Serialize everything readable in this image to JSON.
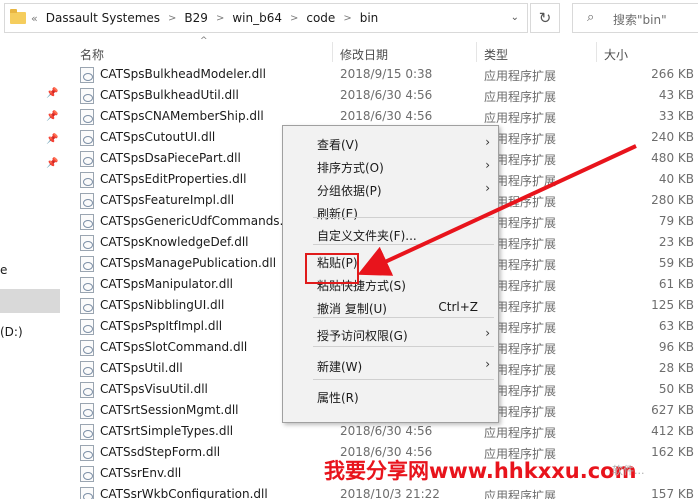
{
  "address": {
    "crumb_back": "«",
    "crumbs": [
      "Dassault Systemes",
      "B29",
      "win_b64",
      "code",
      "bin"
    ],
    "separator": ">",
    "dropdown": "⌄",
    "refresh": "↻",
    "search_placeholder": "搜索\"bin\""
  },
  "nav": {
    "label_e": "e",
    "label_drive": "(D:)"
  },
  "columns": {
    "name": "名称",
    "date": "修改日期",
    "type": "类型",
    "size": "大小",
    "sort_indicator": "^"
  },
  "files": [
    {
      "name": "CATSpsBulkheadModeler.dll",
      "date": "2018/9/15 0:38",
      "type": "应用程序扩展",
      "size": "266 KB"
    },
    {
      "name": "CATSpsBulkheadUtil.dll",
      "date": "2018/6/30 4:56",
      "type": "应用程序扩展",
      "size": "43 KB"
    },
    {
      "name": "CATSpsCNAMemberShip.dll",
      "date": "2018/6/30 4:56",
      "type": "应用程序扩展",
      "size": "33 KB"
    },
    {
      "name": "CATSpsCutoutUI.dll",
      "date": "",
      "type": "应用程序扩展",
      "size": "240 KB"
    },
    {
      "name": "CATSpsDsaPiecePart.dll",
      "date": "",
      "type": "应用程序扩展",
      "size": "480 KB"
    },
    {
      "name": "CATSpsEditProperties.dll",
      "date": "",
      "type": "应用程序扩展",
      "size": "40 KB"
    },
    {
      "name": "CATSpsFeatureImpl.dll",
      "date": "",
      "type": "应用程序扩展",
      "size": "280 KB"
    },
    {
      "name": "CATSpsGenericUdfCommands.d",
      "date": "",
      "type": "应用程序扩展",
      "size": "79 KB"
    },
    {
      "name": "CATSpsKnowledgeDef.dll",
      "date": "",
      "type": "应用程序扩展",
      "size": "23 KB"
    },
    {
      "name": "CATSpsManagePublication.dll",
      "date": "",
      "type": "应用程序扩展",
      "size": "59 KB"
    },
    {
      "name": "CATSpsManipulator.dll",
      "date": "",
      "type": "应用程序扩展",
      "size": "61 KB"
    },
    {
      "name": "CATSpsNibblingUI.dll",
      "date": "",
      "type": "应用程序扩展",
      "size": "125 KB"
    },
    {
      "name": "CATSpsPspItfImpl.dll",
      "date": "",
      "type": "应用程序扩展",
      "size": "63 KB"
    },
    {
      "name": "CATSpsSlotCommand.dll",
      "date": "",
      "type": "应用程序扩展",
      "size": "96 KB"
    },
    {
      "name": "CATSpsUtil.dll",
      "date": "",
      "type": "应用程序扩展",
      "size": "28 KB"
    },
    {
      "name": "CATSpsVisuUtil.dll",
      "date": "",
      "type": "应用程序扩展",
      "size": "50 KB"
    },
    {
      "name": "CATSrtSessionMgmt.dll",
      "date": "",
      "type": "应用程序扩展",
      "size": "627 KB"
    },
    {
      "name": "CATSrtSimpleTypes.dll",
      "date": "2018/6/30 4:56",
      "type": "应用程序扩展",
      "size": "412 KB"
    },
    {
      "name": "CATSsdStepForm.dll",
      "date": "2018/6/30 4:56",
      "type": "应用程序扩展",
      "size": "162 KB"
    },
    {
      "name": "CATSsrEnv.dll",
      "date": "",
      "type": "",
      "size": ""
    },
    {
      "name": "CATSsrWkbConfiguration.dll",
      "date": "2018/10/3 21:22",
      "type": "应用程序扩展",
      "size": "157 KB"
    }
  ],
  "context_menu": {
    "items": [
      {
        "label": "查看(V)",
        "shortcut": "",
        "submenu": true
      },
      {
        "label": "排序方式(O)",
        "shortcut": "",
        "submenu": true
      },
      {
        "label": "分组依据(P)",
        "shortcut": "",
        "submenu": true
      },
      {
        "label": "刷新(E)",
        "shortcut": "",
        "submenu": false
      },
      {
        "label": "自定义文件夹(F)...",
        "shortcut": "",
        "submenu": false
      },
      {
        "label": "粘贴(P)",
        "shortcut": "",
        "submenu": false
      },
      {
        "label": "粘贴快捷方式(S)",
        "shortcut": "",
        "submenu": false
      },
      {
        "label": "撤消 复制(U)",
        "shortcut": "Ctrl+Z",
        "submenu": false
      },
      {
        "label": "授予访问权限(G)",
        "shortcut": "",
        "submenu": true
      },
      {
        "label": "新建(W)",
        "shortcut": "",
        "submenu": true
      },
      {
        "label": "属性(R)",
        "shortcut": "",
        "submenu": false
      }
    ],
    "submenu_arrow": "›"
  },
  "watermark": {
    "text": "我要分享网www.hhkxxu.com",
    "faint_text": "软件..."
  },
  "colors": {
    "highlight": "#e01b1b",
    "arrow": "#e8141c",
    "selection": "#d9d9d9"
  }
}
